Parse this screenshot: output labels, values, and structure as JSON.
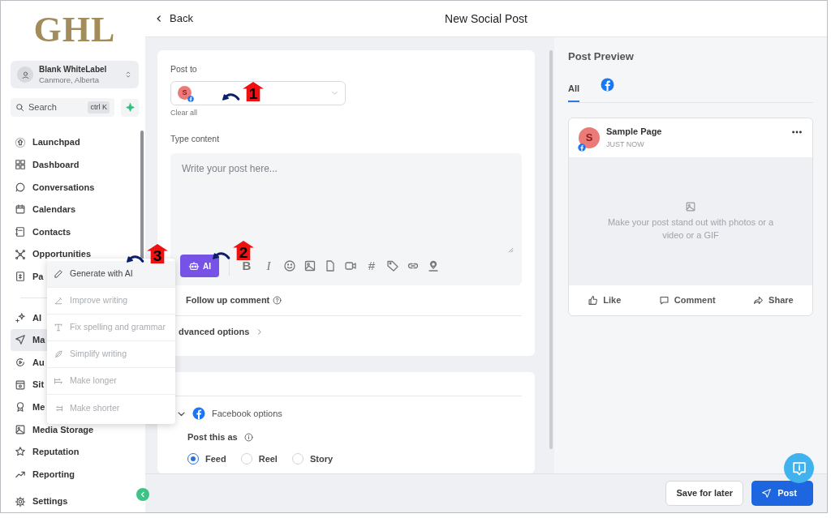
{
  "brand": {
    "logo": "GHL"
  },
  "account": {
    "name": "Blank WhiteLabel",
    "location": "Canmore, Alberta"
  },
  "search": {
    "placeholder": "Search",
    "shortcut": "ctrl K"
  },
  "nav": [
    {
      "label": "Launchpad",
      "selected": false
    },
    {
      "label": "Dashboard",
      "selected": false
    },
    {
      "label": "Conversations",
      "selected": false
    },
    {
      "label": "Calendars",
      "selected": false
    },
    {
      "label": "Contacts",
      "selected": false
    },
    {
      "label": "Opportunities",
      "selected": false
    },
    {
      "label": "Pa",
      "selected": false
    },
    {
      "label": "AI",
      "selected": false
    },
    {
      "label": "Ma",
      "selected": true
    },
    {
      "label": "Au",
      "selected": false
    },
    {
      "label": "Sit",
      "selected": false
    },
    {
      "label": "Me",
      "selected": false
    },
    {
      "label": "Media Storage",
      "selected": false
    },
    {
      "label": "Reputation",
      "selected": false
    },
    {
      "label": "Reporting",
      "selected": false
    },
    {
      "label": "Settings",
      "selected": false
    }
  ],
  "ai_menu": [
    {
      "label": "Generate with AI",
      "disabled": false
    },
    {
      "label": "Improve writing",
      "disabled": true
    },
    {
      "label": "Fix spelling and grammar",
      "disabled": true
    },
    {
      "label": "Simplify writing",
      "disabled": true
    },
    {
      "label": "Make longer",
      "disabled": true
    },
    {
      "label": "Make shorter",
      "disabled": true
    }
  ],
  "header": {
    "back": "Back",
    "title": "New Social Post"
  },
  "composer": {
    "post_to_label": "Post to",
    "avatar": "S",
    "clear_all": "Clear all",
    "content_label": "Type content",
    "placeholder": "Write your post here...",
    "ai_button": "AI",
    "tools": [
      {
        "kind": "bold",
        "text": "B"
      },
      {
        "kind": "italic",
        "text": "I"
      },
      {
        "kind": "emoji"
      },
      {
        "kind": "image"
      },
      {
        "kind": "file"
      },
      {
        "kind": "video"
      },
      {
        "kind": "hashtag",
        "text": "#"
      },
      {
        "kind": "tag"
      },
      {
        "kind": "link"
      },
      {
        "kind": "location"
      }
    ],
    "follow_up": "Follow up comment",
    "advanced": "dvanced options"
  },
  "facebook_options": {
    "title": "Facebook options",
    "post_as_label": "Post this as",
    "choices": [
      {
        "label": "Feed",
        "selected": true
      },
      {
        "label": "Reel",
        "selected": false
      },
      {
        "label": "Story",
        "selected": false
      }
    ]
  },
  "preview": {
    "title": "Post Preview",
    "tabs": [
      {
        "kind": "text",
        "label": "All",
        "selected": true
      },
      {
        "kind": "facebook",
        "selected": false
      }
    ],
    "avatar": "S",
    "page_name": "Sample Page",
    "time": "JUST NOW",
    "media_hint": "Make your post stand out with photos or a video or a GIF",
    "actions": [
      "Like",
      "Comment",
      "Share"
    ]
  },
  "footer": {
    "buttons": [
      {
        "label": "Save for later",
        "kind": "secondary"
      },
      {
        "label": "Post",
        "kind": "primary"
      }
    ]
  },
  "annotations": [
    {
      "label": "1"
    },
    {
      "label": "2"
    },
    {
      "label": "3"
    }
  ]
}
